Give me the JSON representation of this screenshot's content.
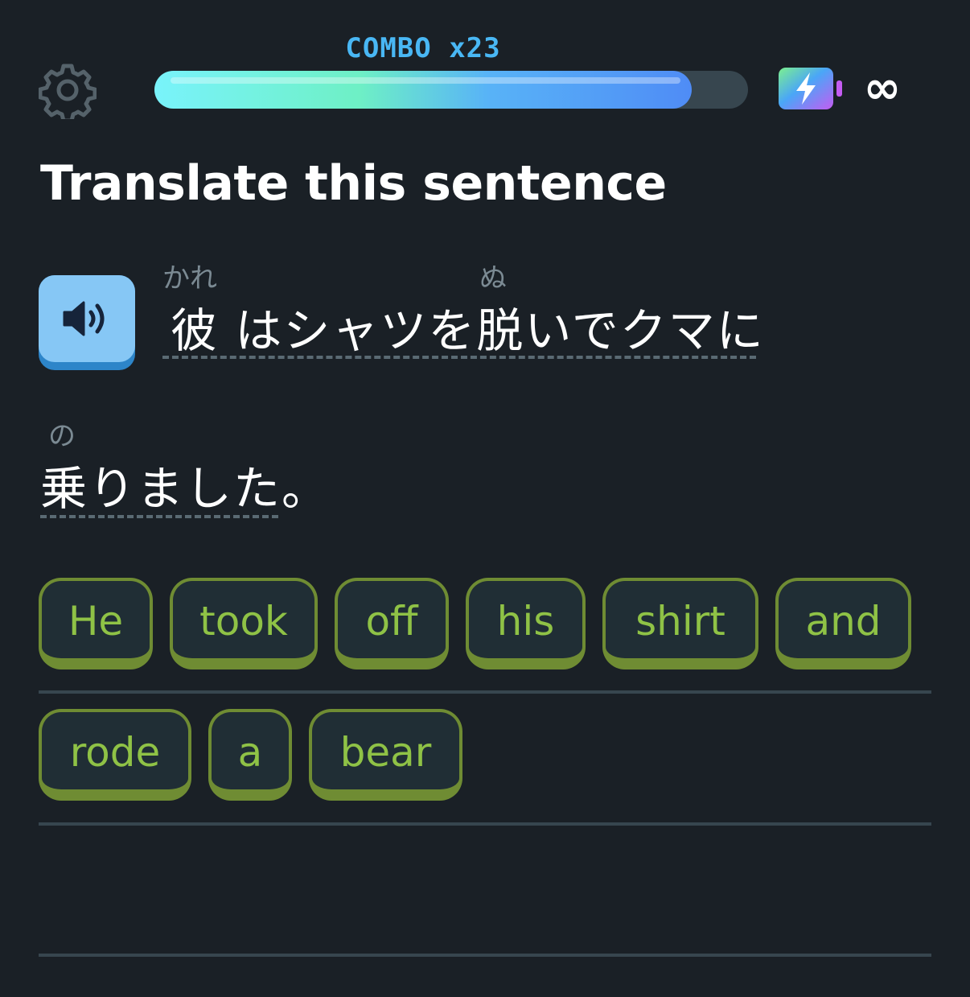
{
  "header": {
    "combo_label": "COMBO x23",
    "progress": 0.905,
    "energy_label": "∞",
    "settings_icon": "gear-icon",
    "energy_icon": "lightning-battery-icon"
  },
  "title": "Translate this sentence",
  "prompt": {
    "speaker_icon": "speaker-icon",
    "line1": {
      "ruby_kare": "かれ",
      "ruby_nu": "ぬ",
      "text": "彼 はシャツを脱いでクマに"
    },
    "line2": {
      "ruby_no": "の",
      "text": "乗りました。"
    }
  },
  "answer": {
    "row1": [
      "He",
      "took",
      "off",
      "his",
      "shirt",
      "and"
    ],
    "row2": [
      "rode",
      "a",
      "bear"
    ]
  },
  "colors": {
    "background": "#1a2026",
    "chip_border": "#6f8c33",
    "chip_text": "#8fc246",
    "combo": "#49b7f4"
  }
}
